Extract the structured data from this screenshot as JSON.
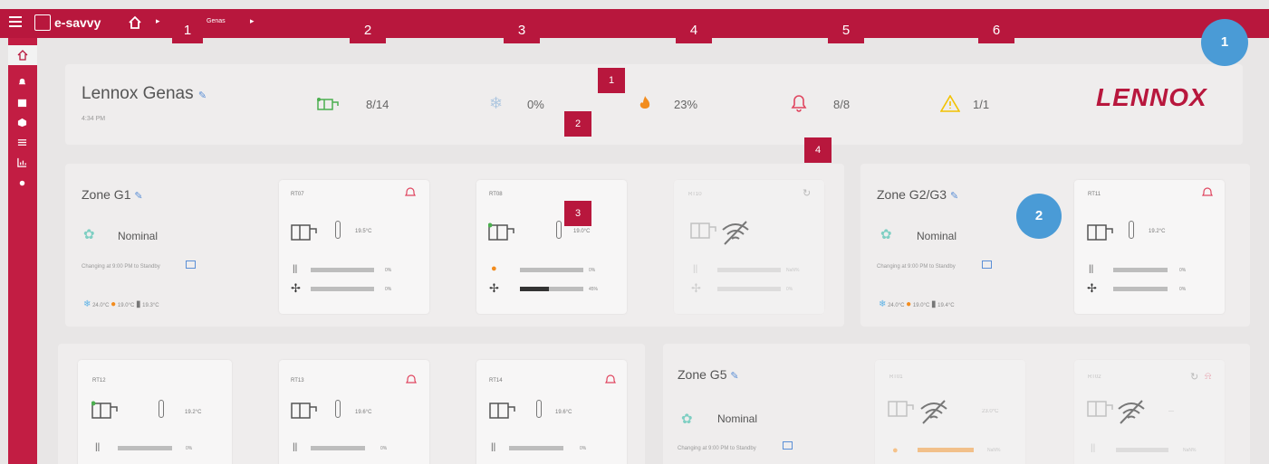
{
  "app": {
    "name": "e-savvy",
    "breadcrumb": "Genas"
  },
  "tabs": [
    "1",
    "2",
    "3",
    "4",
    "5",
    "6"
  ],
  "callouts": {
    "circle1": "1",
    "circle2": "2",
    "m1": "1",
    "m2": "2",
    "m3": "3",
    "m4": "4"
  },
  "site": {
    "name": "Lennox Genas",
    "time": "4:34 PM",
    "logo": "LENNOX",
    "stats": {
      "units": "8/14",
      "cooling": "0%",
      "heating": "23%",
      "alarms": "8/8",
      "warnings": "1/1"
    }
  },
  "zones": {
    "g1": {
      "title": "Zone G1",
      "status": "Nominal",
      "schedule": "Changing at 9:00 PM to Standby",
      "t_cool": "24.0°C",
      "t_heat": "19.0°C",
      "t_room": "19.3°C"
    },
    "g23": {
      "title": "Zone G2/G3",
      "status": "Nominal",
      "schedule": "Changing at 9:00 PM to Standby",
      "t_cool": "24.0°C",
      "t_heat": "19.0°C",
      "t_room": "19.4°C"
    },
    "g5": {
      "title": "Zone G5",
      "status": "Nominal",
      "schedule": "Changing at 9:00 PM to Standby"
    }
  },
  "units": {
    "rt07": {
      "id": "RT07",
      "temp": "19.5°C",
      "p1": "0%",
      "p2": "0%",
      "fill1": 0,
      "fill2": 0
    },
    "rt08": {
      "id": "RT08",
      "temp": "19.0°C",
      "p1": "0%",
      "p2": "45%",
      "fill1": 0,
      "fill2": 0.45
    },
    "rt10": {
      "id": "RT10",
      "p1": "NaN%",
      "p2": "0%"
    },
    "rt11": {
      "id": "RT11",
      "temp": "19.2°C",
      "p1": "0%",
      "p2": "0%"
    },
    "rt12": {
      "id": "RT12",
      "temp": "19.2°C",
      "p1": "0%"
    },
    "rt13": {
      "id": "RT13",
      "temp": "19.6°C",
      "p1": "0%"
    },
    "rt14": {
      "id": "RT14",
      "temp": "19.6°C",
      "p1": "0%"
    },
    "rt01": {
      "id": "RT01",
      "temp": "23.0°C",
      "p1": "NaN%"
    },
    "rt02": {
      "id": "RT02",
      "temp": "---",
      "p1": "NaN%"
    }
  },
  "colors": {
    "brand": "#b8173d",
    "accent_blue": "#4a9bd6",
    "heat": "#f28c1e",
    "warn": "#f2c200",
    "fan": "#333333"
  }
}
